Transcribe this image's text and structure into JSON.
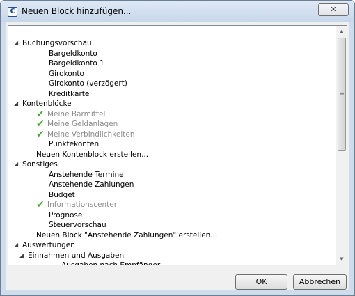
{
  "window": {
    "title": "Neuen Block hinzufügen...",
    "close_glyph": "✕"
  },
  "tree": {
    "groups": [
      {
        "label": "Buchungsvorschau",
        "children": [
          {
            "label": "Bargeldkonto",
            "added": false
          },
          {
            "label": "Bargeldkonto 1",
            "added": false
          },
          {
            "label": "Girokonto",
            "added": false
          },
          {
            "label": "Girokonto (verzögert)",
            "added": false
          },
          {
            "label": "Kreditkarte",
            "added": false
          }
        ]
      },
      {
        "label": "Kontenblöcke",
        "children": [
          {
            "label": "Meine Barmittel",
            "added": true
          },
          {
            "label": "Meine Geldanlagen",
            "added": true
          },
          {
            "label": "Meine Verbindlichkeiten",
            "added": true
          },
          {
            "label": "Punktekonten",
            "added": false
          }
        ],
        "create_label": "Neuen Kontenblock erstellen..."
      },
      {
        "label": "Sonstiges",
        "children": [
          {
            "label": "Anstehende Termine",
            "added": false
          },
          {
            "label": "Anstehende Zahlungen",
            "added": false
          },
          {
            "label": "Budget",
            "added": false
          },
          {
            "label": "Informationscenter",
            "added": true
          },
          {
            "label": "Prognose",
            "added": false
          },
          {
            "label": "Steuervorschau",
            "added": false
          }
        ],
        "create_label": "Neuen Block \"Anstehende Zahlungen\" erstellen..."
      },
      {
        "label": "Auswertungen",
        "subgroups": [
          {
            "label": "Einnahmen und Ausgaben",
            "children": [
              {
                "label": "Ausgaben nach Empfänger",
                "added": false
              }
            ]
          }
        ]
      }
    ]
  },
  "buttons": {
    "ok": "OK",
    "cancel": "Abbrechen"
  },
  "icons": {
    "expanded": "expanded-triangle-icon",
    "added": "checkmark-icon"
  },
  "colors": {
    "added_text": "#8b8b8b",
    "checkmark": "#4aa83a",
    "title_bar": "#cfdcec"
  }
}
